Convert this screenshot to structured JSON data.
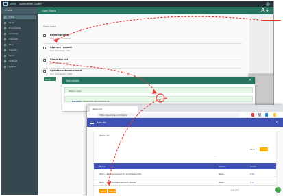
{
  "os_bar": {
    "title": "Notification Center"
  },
  "sidebar": {
    "header": "Profile",
    "items": [
      {
        "label": "Inbox"
      },
      {
        "label": "Tasks"
      },
      {
        "label": "Documents"
      },
      {
        "label": "Contacts"
      },
      {
        "label": "Calendar"
      },
      {
        "label": "Files"
      },
      {
        "label": "Reports"
      },
      {
        "label": "Team"
      },
      {
        "label": "Settings"
      },
      {
        "label": "Logout"
      }
    ]
  },
  "app_header": {
    "title": "Open Tasks",
    "sort_icon": "A↓"
  },
  "main": {
    "section_title": "Open tasks",
    "tasks": [
      {
        "name": "Review invoice",
        "sub": "Due today · Finance"
      },
      {
        "name": "Approve request",
        "sub": "Due tomorrow · HR"
      },
      {
        "name": "Check the list",
        "sub": "Due Friday · Sales"
      },
      {
        "name": "Update customer record",
        "sub": "Due next week · CRM"
      }
    ],
    "chip": "Done",
    "panel_label": "Info"
  },
  "popup": {
    "title": "Task details",
    "row1": "Status: open",
    "row2_text": "Follow-up: Check the list of items at ",
    "row2_link": "this link"
  },
  "browser": {
    "tab_title": "Items list",
    "url": "https://example.com/items",
    "site_title": "Item list",
    "filter_label": "Items list",
    "pager": "10 ▾",
    "table_headers": [
      "Name",
      "Status",
      "Action"
    ],
    "rows": [
      {
        "name": "Item: Approve invoice for purchase order",
        "status": "Open",
        "action": "Edit"
      },
      {
        "name": "Item: Check reimbursement details",
        "status": "Open",
        "action": "Edit"
      }
    ],
    "footer": "1-2 of 2",
    "buttons": [
      "Save",
      "Cancel"
    ],
    "fab_icon": "✓"
  },
  "colors": {
    "teal": "#26735f",
    "indigo": "#3f51b5",
    "annotation_red": "#e53935",
    "orange": "#ff9800"
  }
}
